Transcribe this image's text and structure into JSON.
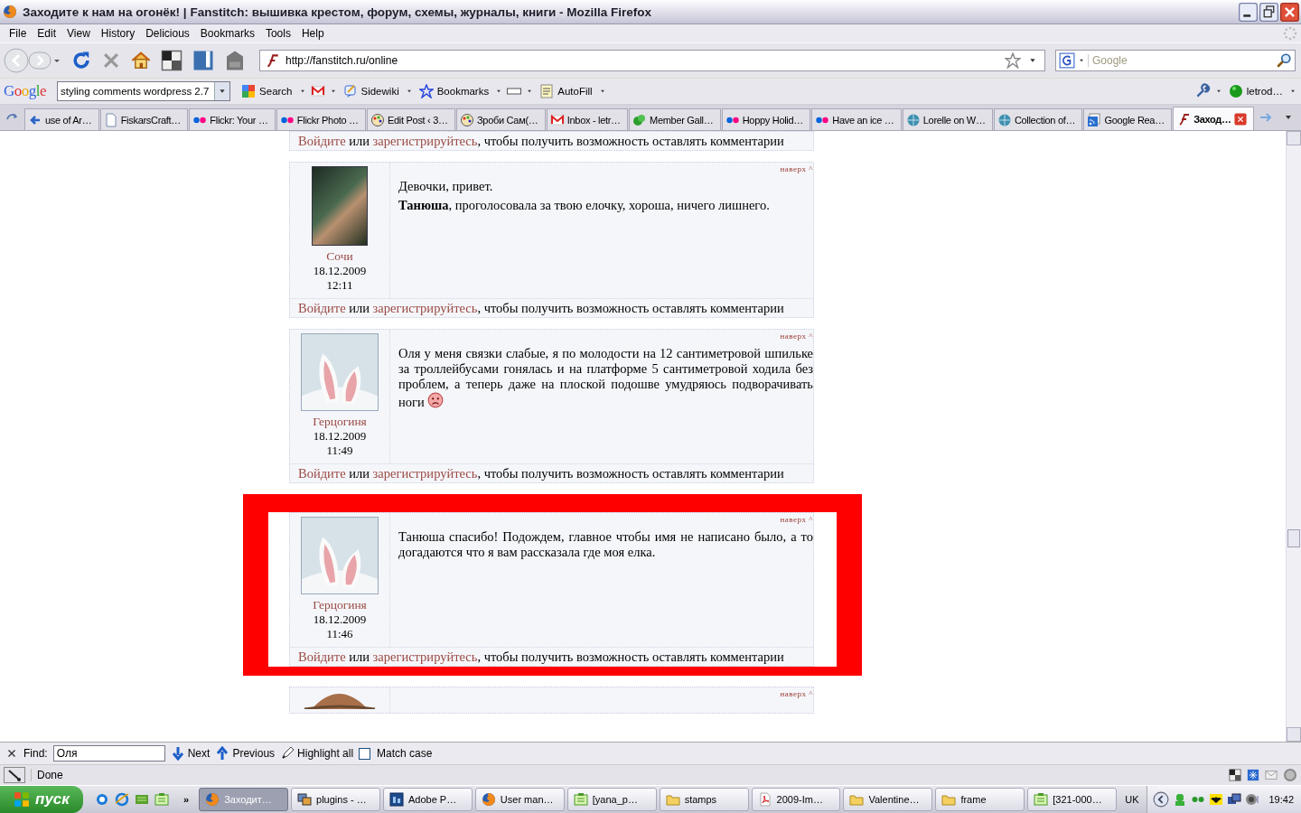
{
  "window": {
    "title": "Заходите к нам на огонёк! | Fanstitch: вышивка крестом, форум, схемы, журналы, книги - Mozilla Firefox"
  },
  "menu": [
    "File",
    "Edit",
    "View",
    "History",
    "Delicious",
    "Bookmarks",
    "Tools",
    "Help"
  ],
  "nav": {
    "url": "http://fanstitch.ru/online",
    "search_placeholder": "Google"
  },
  "google_toolbar": {
    "logo": "Google",
    "query": "styling comments wordpress 2.7",
    "items": [
      {
        "label": "Search"
      },
      {
        "label": "Sidewiki"
      },
      {
        "label": "Bookmarks"
      },
      {
        "label": "AutoFill"
      }
    ],
    "account": "letrod…"
  },
  "tabs": [
    {
      "label": "use of Ar…",
      "selected": false
    },
    {
      "label": "FiskarsCraft…",
      "selected": false
    },
    {
      "label": "Flickr: Your …",
      "selected": false
    },
    {
      "label": "Flickr Photo …",
      "selected": false
    },
    {
      "label": "Edit Post ‹ 3…",
      "selected": false
    },
    {
      "label": "Зроби Сам(…",
      "selected": false
    },
    {
      "label": "Inbox - letr…",
      "selected": false
    },
    {
      "label": "Member Gall…",
      "selected": false
    },
    {
      "label": "Hoppy Holid…",
      "selected": false
    },
    {
      "label": "Have an ice …",
      "selected": false
    },
    {
      "label": "Lorelle on W…",
      "selected": false
    },
    {
      "label": "Collection of…",
      "selected": false
    },
    {
      "label": "Google Rea…",
      "selected": false
    },
    {
      "label": "Заход…",
      "selected": true
    }
  ],
  "comments": [
    {
      "kind": "footer_only",
      "highlighted": false,
      "footer": {
        "login": "Войдите",
        "or": "или",
        "register": "зарегистрируйтесь",
        "rest": ", чтобы получить возможность оставлять комментарии"
      }
    },
    {
      "kind": "full",
      "highlighted": false,
      "to_top": "наверх ^",
      "author": "Сочи",
      "date": "18.12.2009",
      "time": "12:11",
      "paragraphs": [
        "Девочки, привет.",
        "**Танюша**, проголосовала за твою елочку, хороша, ничего лишнего."
      ],
      "footer": {
        "login": "Войдите",
        "or": "или",
        "register": "зарегистрируйтесь",
        "rest": ", чтобы получить возможность оставлять комментарии"
      }
    },
    {
      "kind": "full",
      "highlighted": false,
      "to_top": "наверх ^",
      "author": "Герцогиня",
      "date": "18.12.2009",
      "time": "11:49",
      "paragraphs": [
        "Оля у меня связки слабые, я по молодости на 12 сантиметровой шпильке за троллейбусами гонялась и на платформе 5 сантиметровой ходила без проблем, а теперь даже на плоской подошве умудряюсь подворачивать ноги"
      ],
      "footer": {
        "login": "Войдите",
        "or": "или",
        "register": "зарегистрируйтесь",
        "rest": ", чтобы получить возможность оставлять комментарии"
      }
    },
    {
      "kind": "full",
      "highlighted": true,
      "to_top": "наверх ^",
      "author": "Герцогиня",
      "date": "18.12.2009",
      "time": "11:46",
      "paragraphs": [
        "Танюша спасибо! Подождем, главное чтобы имя не написано было, а то догадаются что я вам рассказала где моя елка."
      ],
      "footer": {
        "login": "Войдите",
        "or": "или",
        "register": "зарегистрируйтесь",
        "rest": ", чтобы получить возможность оставлять комментарии"
      }
    },
    {
      "kind": "header_only",
      "highlighted": false,
      "to_top": "наверх ^"
    }
  ],
  "find_bar": {
    "label": "Find:",
    "value": "Оля",
    "next": "Next",
    "previous": "Previous",
    "highlight": "Highlight all",
    "match_case": {
      "label": "Match case",
      "checked": false
    }
  },
  "status_bar": {
    "text": "Done"
  },
  "taskbar": {
    "start": "пуск",
    "more": "»",
    "tasks": [
      {
        "label": "Заходит…",
        "selected": true
      },
      {
        "label": "plugins - …",
        "selected": false
      },
      {
        "label": "Adobe P…",
        "selected": false
      },
      {
        "label": "User man…",
        "selected": false
      },
      {
        "label": "[yana_p…",
        "selected": false
      },
      {
        "label": "stamps",
        "selected": false
      },
      {
        "label": "2009-Im…",
        "selected": false
      },
      {
        "label": "Valentine…",
        "selected": false
      },
      {
        "label": "frame",
        "selected": false
      },
      {
        "label": "[321-000…",
        "selected": false
      }
    ],
    "language": "UK",
    "clock": "19:42"
  }
}
